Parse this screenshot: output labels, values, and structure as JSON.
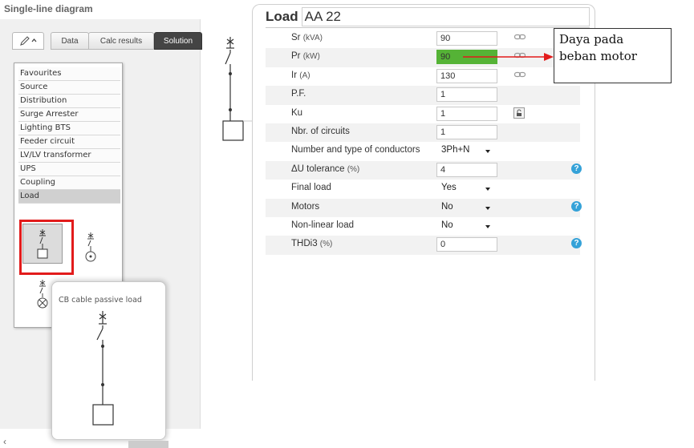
{
  "left_panel": {
    "title": "Single-line diagram",
    "tabs": {
      "edit_icon": "pencil-icon",
      "data": "Data",
      "calc_results": "Calc results",
      "solutions": "Solution"
    },
    "menu_items": [
      {
        "label": "Favourites"
      },
      {
        "label": "Source"
      },
      {
        "label": "Distribution"
      },
      {
        "label": "Surge Arrester"
      },
      {
        "label": "Lighting BTS"
      },
      {
        "label": "Feeder circuit"
      },
      {
        "label": "LV/LV transformer"
      },
      {
        "label": "UPS"
      },
      {
        "label": "Coupling"
      },
      {
        "label": "Load",
        "selected": true
      }
    ],
    "tooltip": "CB cable passive load"
  },
  "form": {
    "title_prefix": "Load",
    "title_name": "AA 22",
    "rows": [
      {
        "label": "Sr",
        "unit": "(kVA)",
        "value": "90",
        "kind": "input",
        "icon": "link-icon"
      },
      {
        "label": "Pr",
        "unit": "(kW)",
        "value": "90",
        "kind": "input",
        "highlight": true,
        "icon": "link-icon"
      },
      {
        "label": "Ir",
        "unit": "(A)",
        "value": "130",
        "kind": "input",
        "icon": "link-icon"
      },
      {
        "label": "P.F.",
        "unit": "",
        "value": "1",
        "kind": "input"
      },
      {
        "label": "Ku",
        "unit": "",
        "value": "1",
        "kind": "input",
        "icon": "lock-icon"
      },
      {
        "label": "Nbr. of circuits",
        "unit": "",
        "value": "1",
        "kind": "input"
      },
      {
        "label": "Number and type of conductors",
        "unit": "",
        "value": "3Ph+N",
        "kind": "select"
      },
      {
        "label": "ΔU tolerance",
        "unit": "(%)",
        "value": "4",
        "kind": "input",
        "icon": "help-icon"
      },
      {
        "label": "Final load",
        "unit": "",
        "value": "Yes",
        "kind": "select"
      },
      {
        "label": "Motors",
        "unit": "",
        "value": "No",
        "kind": "select",
        "icon": "help-icon"
      },
      {
        "label": "Non-linear load",
        "unit": "",
        "value": "No",
        "kind": "select"
      },
      {
        "label": "THDi3",
        "unit": "(%)",
        "value": "0",
        "kind": "input",
        "icon": "help-icon"
      }
    ]
  },
  "annotation": {
    "line1": "Daya pada",
    "line2": "beban motor"
  },
  "colors": {
    "highlight_green": "#55b336",
    "annotation_red": "#e21b1b",
    "help_blue": "#35a2d8"
  }
}
